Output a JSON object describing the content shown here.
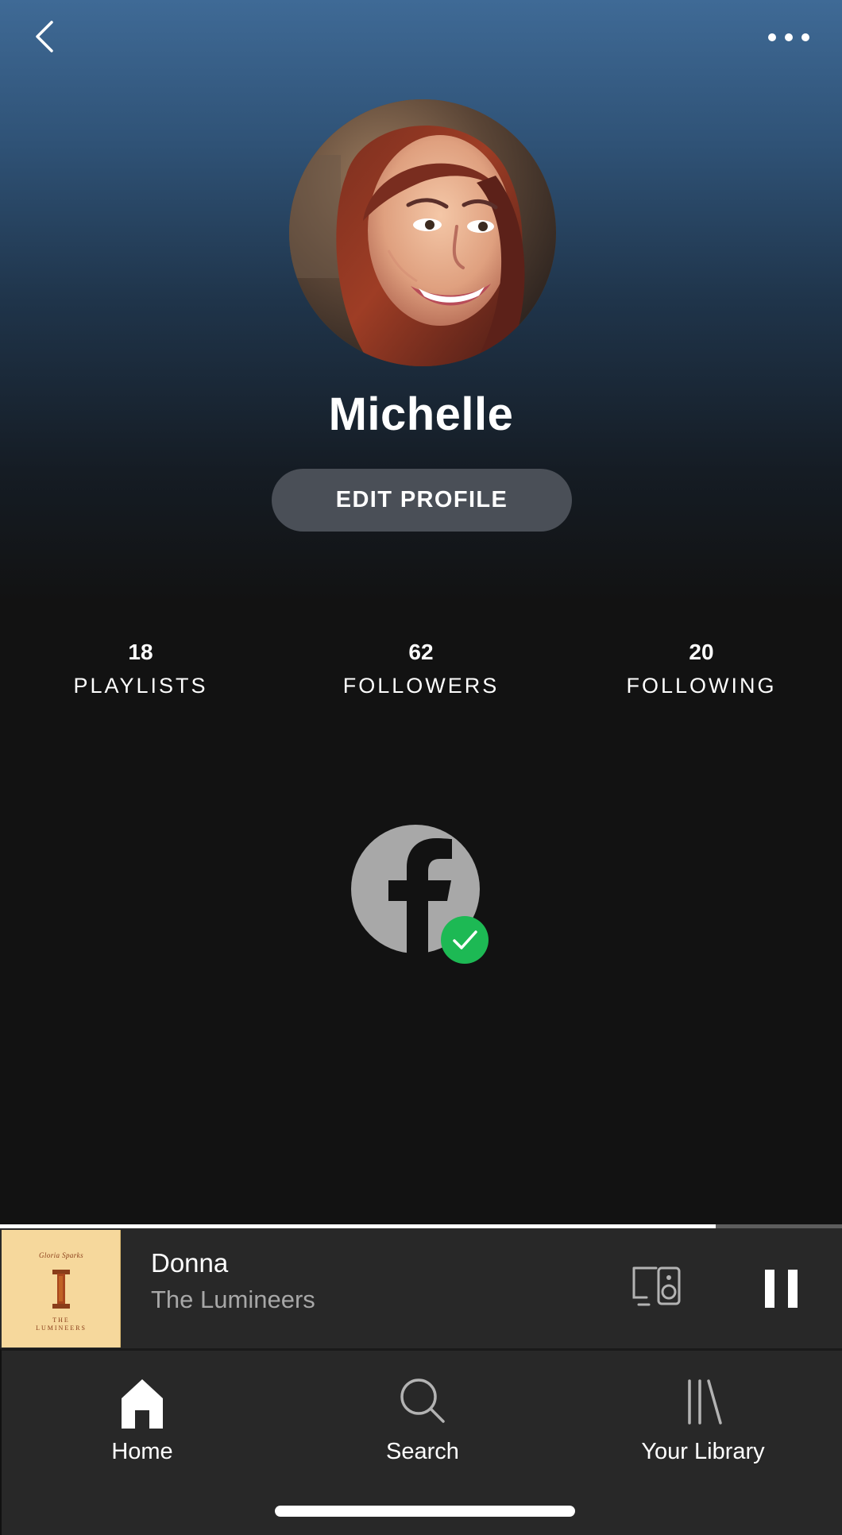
{
  "profile": {
    "name": "Michelle",
    "edit_label": "EDIT PROFILE",
    "avatar_alt": "Profile photo"
  },
  "stats": [
    {
      "count": "18",
      "label": "PLAYLISTS"
    },
    {
      "count": "62",
      "label": "FOLLOWERS"
    },
    {
      "count": "20",
      "label": "FOLLOWING"
    }
  ],
  "connected_account": {
    "icon": "facebook-icon",
    "status_icon": "check-icon",
    "status_color": "#1db954"
  },
  "now_playing": {
    "title": "Donna",
    "artist": "The Lumineers",
    "progress": 0.85,
    "album_art": {
      "top_text": "Gloria Sparks",
      "numeral": "I",
      "bottom_line_1": "THE",
      "bottom_line_2": "LUMINEERS"
    }
  },
  "nav": {
    "items": [
      {
        "label": "Home",
        "icon": "home-icon",
        "active": true
      },
      {
        "label": "Search",
        "icon": "search-icon",
        "active": false
      },
      {
        "label": "Your Library",
        "icon": "library-icon",
        "active": false
      }
    ]
  },
  "colors": {
    "accent_green": "#1db954",
    "background": "#121212",
    "header_blue": "#3f6a96",
    "player_background": "#282828"
  }
}
